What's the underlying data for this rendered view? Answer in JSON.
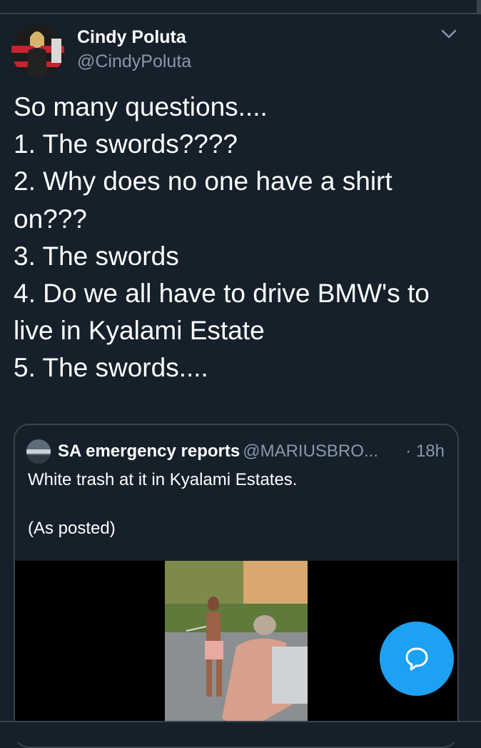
{
  "tweet": {
    "author": {
      "display_name": "Cindy Poluta",
      "handle": "@CindyPoluta"
    },
    "menu_icon": "chevron-down-icon",
    "text": "So many questions....\n1. The swords????\n2. Why does no one have a shirt on???\n3. The swords\n4. Do we all have to drive BMW's to live in Kyalami Estate\n5. The swords...."
  },
  "quoted_tweet": {
    "author_name": "SA emergency reports",
    "handle": "@MARIUSBRO...",
    "time": "· 18h",
    "text": "White trash at it in Kyalami Estates.\n\n(As posted)"
  },
  "fab": {
    "icon": "compose-reply-icon",
    "color": "#1da1f2"
  },
  "colors": {
    "background": "#15202b",
    "secondary_text": "#8899a6",
    "border": "#38444d",
    "accent": "#1da1f2"
  }
}
